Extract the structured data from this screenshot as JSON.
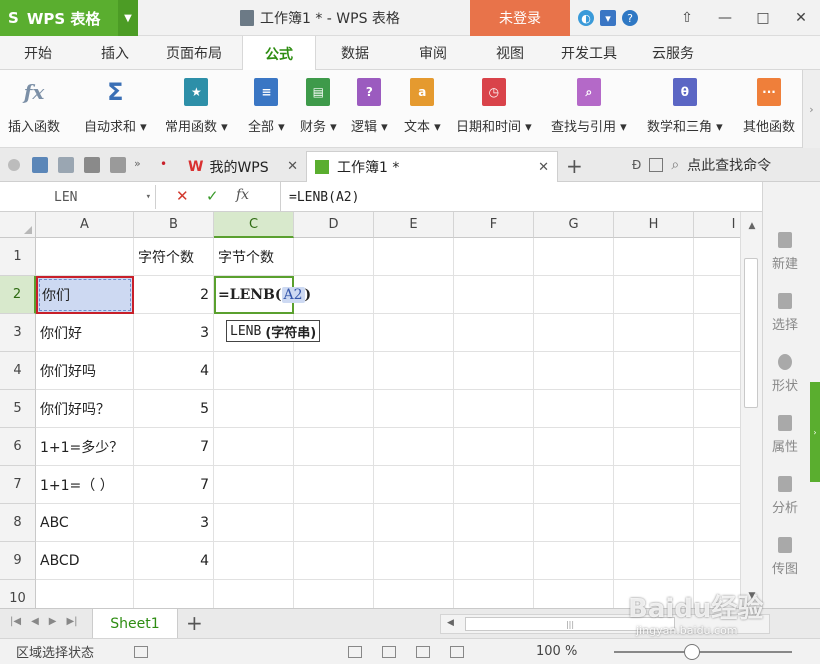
{
  "titlebar": {
    "app_name": "WPS 表格",
    "window_title": "工作簿1 * - WPS 表格",
    "login_label": "未登录"
  },
  "menu": {
    "tabs": [
      "开始",
      "插入",
      "页面布局",
      "公式",
      "数据",
      "审阅",
      "视图",
      "开发工具",
      "云服务"
    ],
    "active": "公式"
  },
  "ribbon": {
    "buttons": [
      {
        "label": "插入函数",
        "icon": "fx-icon",
        "color": "#7b8fa6"
      },
      {
        "label": "自动求和",
        "icon": "sigma-icon",
        "color": "#3a6fb5"
      },
      {
        "label": "常用函数",
        "icon": "star-book-icon",
        "color": "#2d8fa8"
      },
      {
        "label": "全部",
        "icon": "book-icon",
        "color": "#3a76c4"
      },
      {
        "label": "财务",
        "icon": "finance-icon",
        "color": "#3e9a4a"
      },
      {
        "label": "逻辑",
        "icon": "logic-icon",
        "color": "#9b5bbf"
      },
      {
        "label": "文本",
        "icon": "text-icon",
        "color": "#e59a2f"
      },
      {
        "label": "日期和时间",
        "icon": "clock-icon",
        "color": "#d9434a"
      },
      {
        "label": "查找与引用",
        "icon": "search-book-icon",
        "color": "#b469c8"
      },
      {
        "label": "数学和三角",
        "icon": "math-icon",
        "color": "#5b66c4"
      },
      {
        "label": "其他函数",
        "icon": "more-icon",
        "color": "#ef7f3a"
      }
    ]
  },
  "quickbar": {
    "wps_tab": "我的WPS",
    "book_tab": "工作簿1 *",
    "search_label": "点此查找命令"
  },
  "formulabar": {
    "name_box": "LEN",
    "formula": "=LENB(A2)"
  },
  "sheet": {
    "columns": [
      "A",
      "B",
      "C",
      "D",
      "E",
      "F",
      "G",
      "H",
      "I"
    ],
    "row_numbers": [
      "1",
      "2",
      "3",
      "4",
      "5",
      "6",
      "7",
      "8",
      "9",
      "10"
    ],
    "headers": {
      "b1": "字符个数",
      "c1": "字节个数"
    },
    "rows": [
      {
        "a": "你们",
        "b": "2"
      },
      {
        "a": "你们好",
        "b": "3"
      },
      {
        "a": "你们好吗",
        "b": "4"
      },
      {
        "a": "你们好吗？",
        "b": "5"
      },
      {
        "a": "1+1=多少？",
        "b": "7"
      },
      {
        "a": "1+1=（  ）",
        "b": "7"
      },
      {
        "a": "ABC",
        "b": "3"
      },
      {
        "a": "ABCD",
        "b": "4"
      }
    ],
    "edit_prefix": "=LENB",
    "edit_open": "(",
    "edit_ref": "A2",
    "edit_close": ")",
    "tooltip_fn": "LENB",
    "tooltip_arg": "(字符串)"
  },
  "sidepanel": {
    "items": [
      "新建",
      "选择",
      "形状",
      "属性",
      "分析",
      "传图"
    ]
  },
  "sheet_tabs": {
    "active": "Sheet1"
  },
  "statusbar": {
    "status": "区域选择状态",
    "zoom": "100 %"
  },
  "watermark": {
    "text": "Baidu经验",
    "sub": "jingyan.baidu.com"
  }
}
